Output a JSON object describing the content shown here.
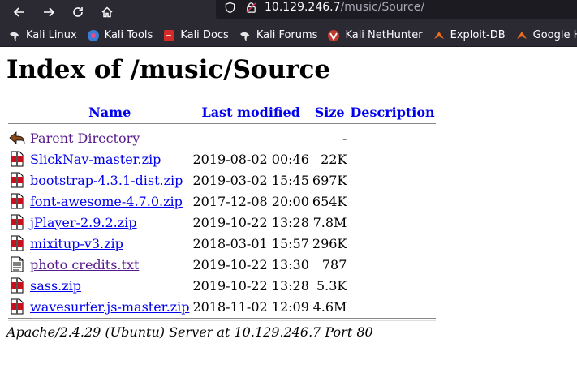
{
  "browser": {
    "url_host": "10.129.246.7",
    "url_path": "/music/Source/",
    "bookmarks": [
      {
        "label": "Kali Linux",
        "icon": "kali-dragon-icon"
      },
      {
        "label": "Kali Tools",
        "icon": "kali-tools-icon"
      },
      {
        "label": "Kali Docs",
        "icon": "kali-docs-icon"
      },
      {
        "label": "Kali Forums",
        "icon": "kali-forums-icon"
      },
      {
        "label": "Kali NetHunter",
        "icon": "nethunter-icon"
      },
      {
        "label": "Exploit-DB",
        "icon": "exploit-db-icon"
      },
      {
        "label": "Google Hacking DB",
        "icon": "ghdb-icon"
      }
    ]
  },
  "page": {
    "title": "Index of /music/Source",
    "headers": {
      "name": "Name",
      "modified": "Last modified",
      "size": "Size",
      "description": "Description"
    },
    "parent": {
      "name": "Parent Directory",
      "size": "-"
    },
    "files": [
      {
        "name": "SlickNav-master.zip",
        "modified": "2019-08-02 00:46",
        "size": "22K",
        "icon": "archive"
      },
      {
        "name": "bootstrap-4.3.1-dist.zip",
        "modified": "2019-03-02 15:45",
        "size": "697K",
        "icon": "archive"
      },
      {
        "name": "font-awesome-4.7.0.zip",
        "modified": "2017-12-08 20:00",
        "size": "654K",
        "icon": "archive"
      },
      {
        "name": "jPlayer-2.9.2.zip",
        "modified": "2019-10-22 13:28",
        "size": "7.8M",
        "icon": "archive"
      },
      {
        "name": "mixitup-v3.zip",
        "modified": "2018-03-01 15:57",
        "size": "296K",
        "icon": "archive"
      },
      {
        "name": "photo credits.txt",
        "modified": "2019-10-22 13:30",
        "size": "787",
        "icon": "text"
      },
      {
        "name": "sass.zip",
        "modified": "2019-10-22 13:28",
        "size": "5.3K",
        "icon": "archive"
      },
      {
        "name": "wavesurfer.js-master.zip",
        "modified": "2018-11-02 12:09",
        "size": "4.6M",
        "icon": "archive"
      }
    ],
    "footer": "Apache/2.4.29 (Ubuntu) Server at 10.129.246.7 Port 80"
  }
}
